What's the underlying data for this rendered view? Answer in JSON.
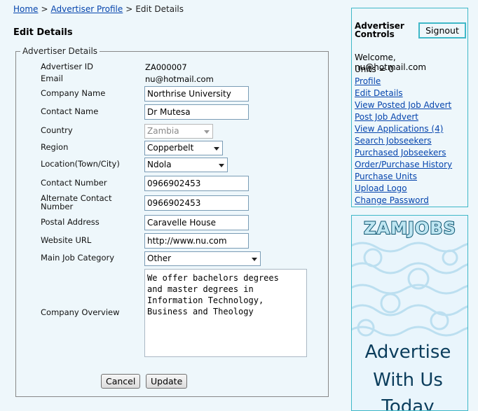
{
  "breadcrumb": {
    "home": "Home",
    "sep1": ">",
    "advertiser_profile": "Advertiser Profile",
    "sep2": ">",
    "current": "Edit Details"
  },
  "page_title": "Edit Details",
  "form": {
    "legend": "Advertiser Details",
    "advertiser_id_label": "Advertiser ID",
    "advertiser_id_value": "ZA000007",
    "email_label": "Email",
    "email_value": "nu@hotmail.com",
    "company_name_label": "Company Name",
    "company_name_value": "Northrise University",
    "contact_name_label": "Contact Name",
    "contact_name_value": "Dr Mutesa",
    "country_label": "Country",
    "country_value": "Zambia",
    "region_label": "Region",
    "region_value": "Copperbelt",
    "location_label": "Location(Town/City)",
    "location_value": "Ndola",
    "contact_number_label": "Contact Number",
    "contact_number_value": "0966902453",
    "alt_contact_label": "Alternate Contact Number",
    "alt_contact_value": "0966902453",
    "postal_address_label": "Postal Address",
    "postal_address_value": "Caravelle House",
    "website_label": "Website URL",
    "website_value": "http://www.nu.com",
    "job_category_label": "Main Job Category",
    "job_category_value": "Other",
    "overview_label": "Company Overview",
    "overview_value": "We offer bachelors degrees\nand master degrees in\nInformation Technology,\nBusiness and Theology",
    "cancel_label": "Cancel",
    "update_label": "Update"
  },
  "controls": {
    "title": "Advertiser Controls",
    "signout_label": "Signout",
    "welcome": "Welcome, nu@hotmail.com",
    "units": "Units = 0",
    "links": [
      "Profile",
      "Edit Details",
      "View Posted Job Advert",
      "Post Job Advert",
      "View Applications (4)",
      "Search Jobseekers",
      "Purchased Jobseekers",
      "Order/Purchase History",
      "Purchase Units",
      "Upload Logo",
      "Change Password"
    ]
  },
  "ad": {
    "logo": "ZAMJOBS",
    "line1": "Advertise",
    "line2": "With Us",
    "line3": "Today",
    "brand_color": "#0e5672",
    "text_color": "#0b3d5c",
    "accent_color": "#3fb8c8"
  }
}
